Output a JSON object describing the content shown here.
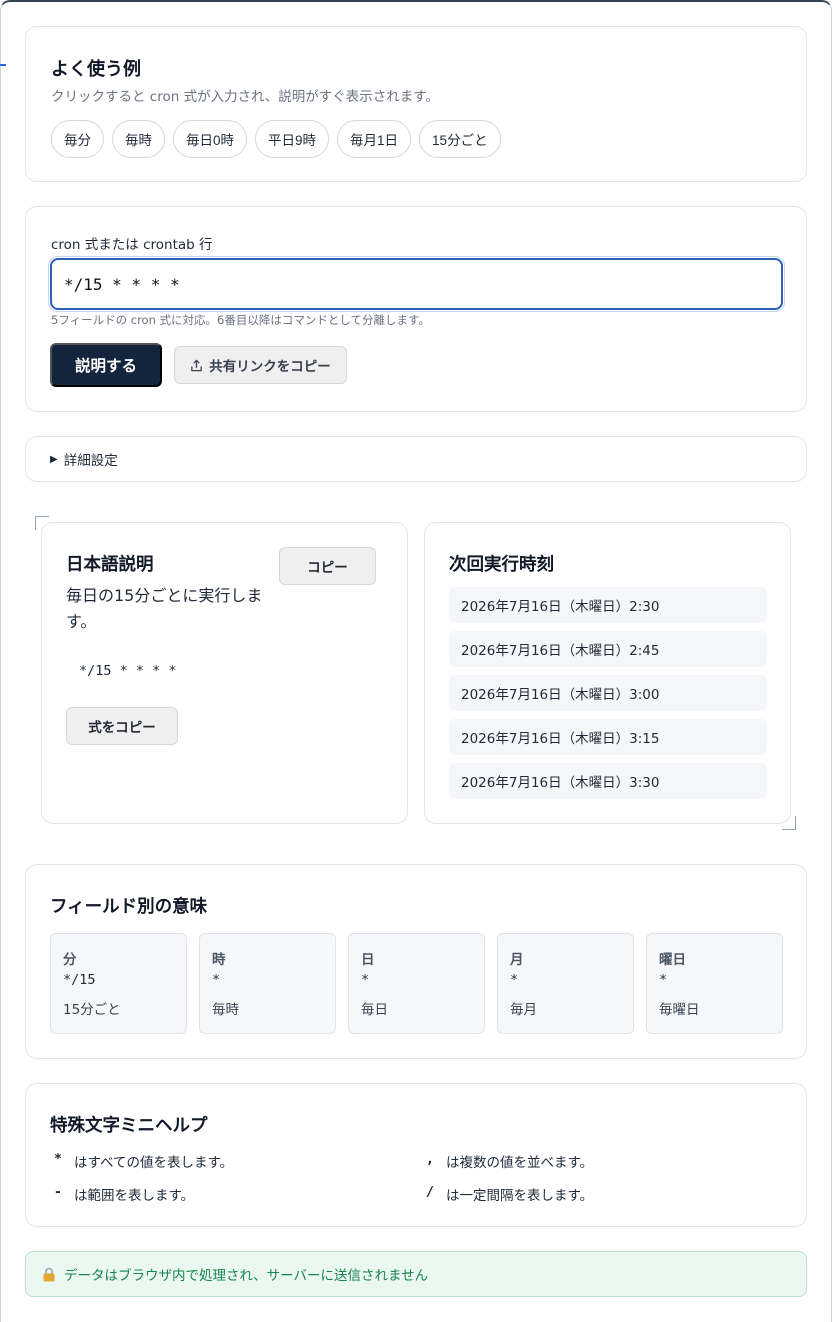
{
  "examples": {
    "title": "よく使う例",
    "subtitle": "クリックすると cron 式が入力され、説明がすぐ表示されます。",
    "chips": [
      "毎分",
      "毎時",
      "毎日0時",
      "平日9時",
      "毎月1日",
      "15分ごと"
    ]
  },
  "input": {
    "label": "cron 式または crontab 行",
    "value": "*/15 * * * *",
    "hint": "5フィールドの cron 式に対応。6番目以降はコマンドとして分離します。",
    "explain_button": "説明する",
    "share_button": "共有リンクをコピー"
  },
  "advanced": {
    "label": "詳細設定"
  },
  "description": {
    "title": "日本語説明",
    "copy_button": "コピー",
    "text": "毎日の15分ごとに実行します。",
    "expression": "*/15 * * * *",
    "expr_copy_button": "式をコピー"
  },
  "next_runs": {
    "title": "次回実行時刻",
    "items": [
      "2026年7月16日（木曜日）2:30",
      "2026年7月16日（木曜日）2:45",
      "2026年7月16日（木曜日）3:00",
      "2026年7月16日（木曜日）3:15",
      "2026年7月16日（木曜日）3:30"
    ]
  },
  "fields": {
    "title": "フィールド別の意味",
    "items": [
      {
        "name": "分",
        "value": "*/15",
        "meaning": "15分ごと"
      },
      {
        "name": "時",
        "value": "*",
        "meaning": "毎時"
      },
      {
        "name": "日",
        "value": "*",
        "meaning": "毎日"
      },
      {
        "name": "月",
        "value": "*",
        "meaning": "毎月"
      },
      {
        "name": "曜日",
        "value": "*",
        "meaning": "毎曜日"
      }
    ]
  },
  "help": {
    "title": "特殊文字ミニヘルプ",
    "items": [
      {
        "symbol": "*",
        "text": "はすべての値を表します。"
      },
      {
        "symbol": ",",
        "text": "は複数の値を並べます。"
      },
      {
        "symbol": "-",
        "text": "は範囲を表します。"
      },
      {
        "symbol": "/",
        "text": "は一定間隔を表します。"
      }
    ]
  },
  "privacy": {
    "text": "データはブラウザ内で処理され、サーバーに送信されません"
  },
  "icons": {
    "share": "share-icon",
    "lock": "lock-icon"
  }
}
